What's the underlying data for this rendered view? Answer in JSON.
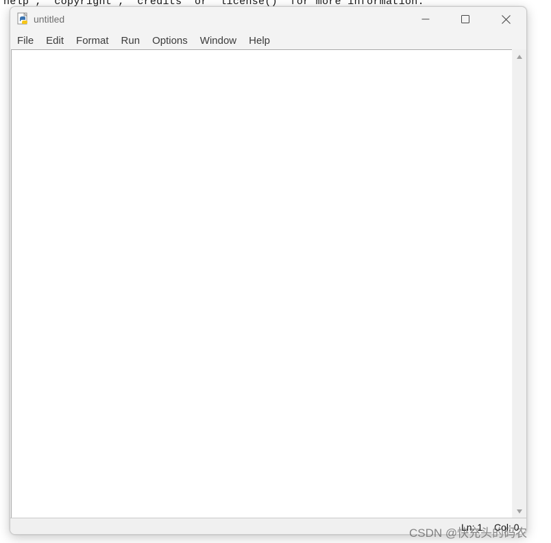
{
  "background_console": {
    "text": "help”,  copyright”,  credits  or  license()  for more information."
  },
  "window": {
    "title": "untitled",
    "icon": "python-idle-icon",
    "controls": {
      "minimize_icon": "minimize-icon",
      "maximize_icon": "maximize-icon",
      "close_icon": "close-icon"
    }
  },
  "menu": {
    "items": [
      {
        "label": "File"
      },
      {
        "label": "Edit"
      },
      {
        "label": "Format"
      },
      {
        "label": "Run"
      },
      {
        "label": "Options"
      },
      {
        "label": "Window"
      },
      {
        "label": "Help"
      }
    ]
  },
  "editor": {
    "content": ""
  },
  "status": {
    "line": "Ln: 1",
    "column": "Col: 0"
  },
  "watermark": {
    "text": "CSDN @快充头的码农"
  }
}
